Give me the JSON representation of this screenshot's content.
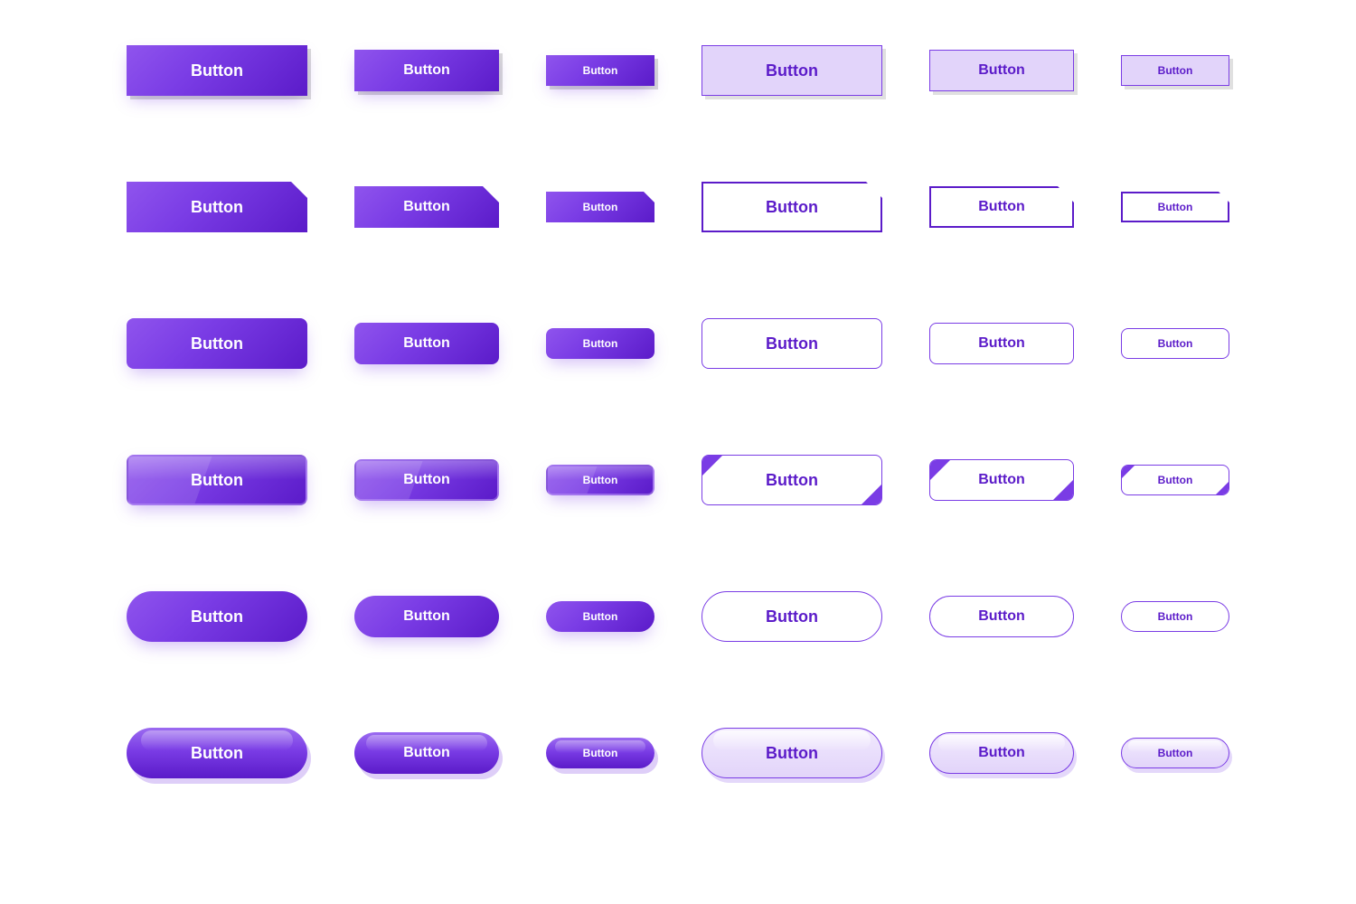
{
  "label": "Button",
  "colors": {
    "primary": "#7A3CE5",
    "primary_dark": "#5B1BC9",
    "primary_light": "#E2D4FA"
  },
  "rows": [
    {
      "style": "square-offset-shadow"
    },
    {
      "style": "cut-corner"
    },
    {
      "style": "rounded-soft"
    },
    {
      "style": "rounded-glossy"
    },
    {
      "style": "pill"
    },
    {
      "style": "pill-glossy"
    }
  ],
  "columns": [
    {
      "variant": "filled",
      "size": "large"
    },
    {
      "variant": "filled",
      "size": "medium"
    },
    {
      "variant": "filled",
      "size": "small"
    },
    {
      "variant": "outlined",
      "size": "large"
    },
    {
      "variant": "outlined",
      "size": "medium"
    },
    {
      "variant": "outlined",
      "size": "small"
    }
  ]
}
